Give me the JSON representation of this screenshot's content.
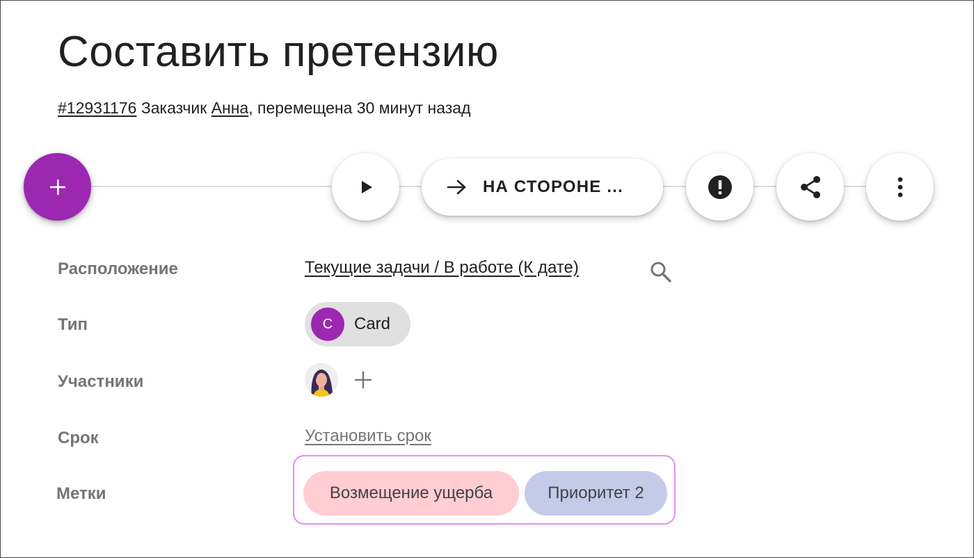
{
  "header": {
    "title": "Составить претензию",
    "subtitle": {
      "id_link": "#12931176",
      "customer_prefix": "Заказчик",
      "customer_link": "Анна",
      "moved_text": ", перемещена 30 минут назад"
    }
  },
  "actionbar": {
    "add_button": {
      "icon": "plus-icon"
    },
    "play_button": {
      "icon": "play-icon"
    },
    "status_button": {
      "icon": "arrow-right-icon",
      "label": "НА СТОРОНЕ ..."
    },
    "alert_button": {
      "icon": "exclamation-circle-icon"
    },
    "share_button": {
      "icon": "share-icon"
    },
    "more_button": {
      "icon": "more-vertical-icon"
    }
  },
  "properties": {
    "location": {
      "label": "Расположение",
      "value": "Текущие задачи / В работе (К дате)",
      "icon": "search-icon"
    },
    "type": {
      "label": "Тип",
      "avatar_letter": "C",
      "value": "Card"
    },
    "members": {
      "label": "Участники",
      "add_icon": "plus-icon"
    },
    "due": {
      "label": "Срок",
      "value": "Установить срок"
    },
    "tags": {
      "label": "Метки",
      "items": [
        {
          "label": "Возмещение ущерба",
          "color": "#ffcdd2"
        },
        {
          "label": "Приоритет 2",
          "color": "#c5cae9"
        }
      ]
    }
  },
  "colors": {
    "accent": "#9c27b0",
    "tags_outline": "#e08ef5"
  }
}
